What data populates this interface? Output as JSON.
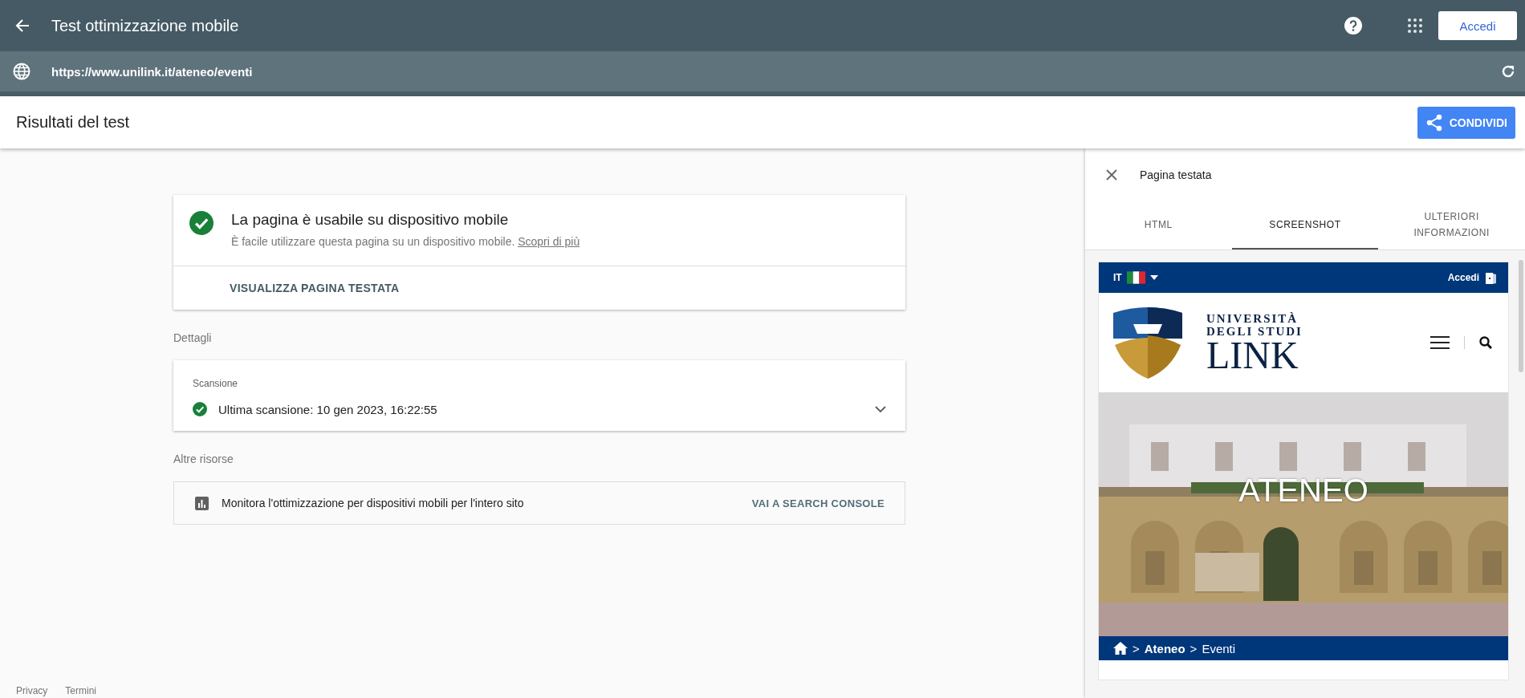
{
  "app_bar": {
    "title": "Test ottimizzazione mobile",
    "login_button": "Accedi"
  },
  "url_bar": {
    "url": "https://www.unilink.it/ateneo/eventi"
  },
  "results_header": {
    "title": "Risultati del test",
    "share_button": "CONDIVIDI"
  },
  "summary_card": {
    "passed": true,
    "title": "La pagina è usabile su dispositivo mobile",
    "description": "È facile utilizzare questa pagina su un dispositivo mobile.",
    "link": "Scopri di più",
    "action": "VISUALIZZA PAGINA TESTATA"
  },
  "details": {
    "heading": "Dettagli",
    "section": "Scansione",
    "items": [
      {
        "text": "Ultima scansione: 10 gen 2023, 16:22:55",
        "passed": true,
        "expanded": false
      }
    ]
  },
  "resources": {
    "heading": "Altre risorse",
    "items": [
      {
        "text": "Monitora l'ottimizzazione per dispositivi mobili per l'intero sito",
        "action": "VAI A SEARCH CONSOLE"
      }
    ]
  },
  "footer": {
    "links": [
      "Privacy",
      "Termini"
    ]
  },
  "side_panel": {
    "title": "Pagina testata",
    "tabs": [
      {
        "label": "HTML",
        "selected": false
      },
      {
        "label": "SCREENSHOT",
        "selected": true
      },
      {
        "label": "ULTERIORI INFORMAZIONI",
        "selected": false
      }
    ],
    "screenshot": {
      "language": "IT",
      "login": "Accedi",
      "logo_lines": [
        "UNIVERSITÀ",
        "DEGLI STUDI",
        "LINK"
      ],
      "hero": {
        "kind": "picture",
        "title": "ATENEO"
      },
      "breadcrumb_separator": ">",
      "breadcrumb": [
        {
          "label": "Ateneo",
          "current": false
        },
        {
          "label": "Eventi",
          "current": true
        }
      ]
    }
  }
}
